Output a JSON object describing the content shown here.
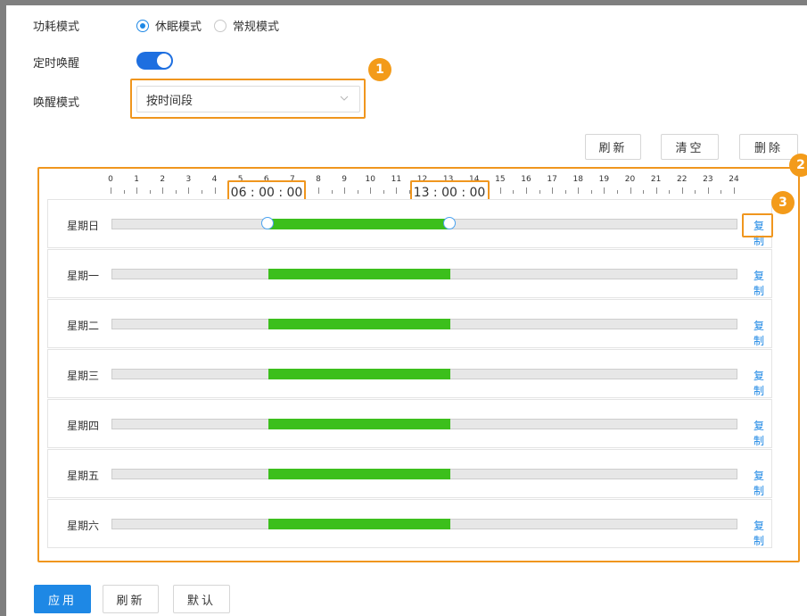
{
  "power_mode": {
    "label": "功耗模式",
    "options": [
      {
        "label": "休眠模式",
        "checked": true
      },
      {
        "label": "常规模式",
        "checked": false
      }
    ]
  },
  "timed_wakeup": {
    "label": "定时唤醒",
    "enabled": true
  },
  "wakeup_mode": {
    "label": "唤醒模式",
    "value": "按时间段"
  },
  "toolbar": {
    "refresh": "刷新",
    "clear": "清空",
    "delete": "删除"
  },
  "annotations": {
    "badge1": "1",
    "badge2": "2",
    "badge3": "3"
  },
  "timeline": {
    "hours": [
      "0",
      "1",
      "2",
      "3",
      "4",
      "5",
      "6",
      "7",
      "8",
      "9",
      "10",
      "11",
      "12",
      "13",
      "14",
      "15",
      "16",
      "17",
      "18",
      "19",
      "20",
      "21",
      "22",
      "23",
      "24"
    ],
    "tooltip_start": "06 : 00 : 00",
    "tooltip_end": "13 : 00 : 00"
  },
  "schedule": {
    "range_start_hour": 6,
    "range_end_hour": 13,
    "copy_label": "复制",
    "days": [
      "星期日",
      "星期一",
      "星期二",
      "星期三",
      "星期四",
      "星期五",
      "星期六"
    ]
  },
  "footer": {
    "apply": "应用",
    "refresh": "刷新",
    "default": "默认"
  },
  "colors": {
    "accent": "#1e88e5",
    "active_bar": "#3cbf1c",
    "highlight": "#f0961e"
  }
}
